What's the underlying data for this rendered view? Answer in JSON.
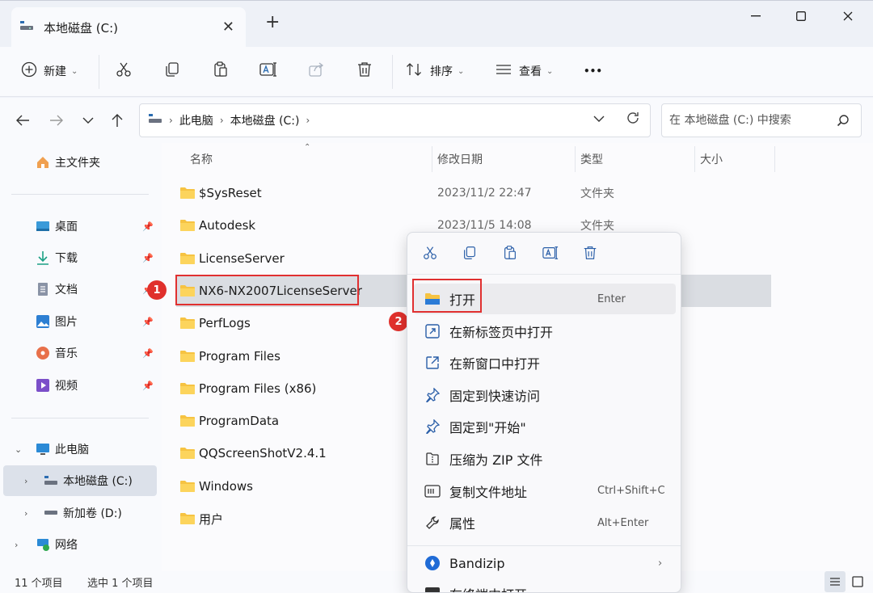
{
  "window": {
    "tab_title": "本地磁盘 (C:)",
    "minimize_glyph": "—",
    "maximize_glyph": "☐",
    "close_glyph": "✕",
    "newtab_glyph": "+"
  },
  "toolbar": {
    "new_label": "新建",
    "sort_label": "排序",
    "view_label": "查看",
    "more_label": "•••"
  },
  "nav": {
    "breadcrumb": [
      "此电脑",
      "本地磁盘 (C:)"
    ],
    "search_placeholder": "在 本地磁盘 (C:) 中搜索"
  },
  "sidebar": {
    "home": "主文件夹",
    "quick_access": [
      {
        "label": "桌面",
        "icon": "desktop-icon"
      },
      {
        "label": "下载",
        "icon": "download-icon"
      },
      {
        "label": "文档",
        "icon": "document-icon"
      },
      {
        "label": "图片",
        "icon": "picture-icon"
      },
      {
        "label": "音乐",
        "icon": "music-icon"
      },
      {
        "label": "视频",
        "icon": "video-icon"
      }
    ],
    "this_pc": "此电脑",
    "drive_c": "本地磁盘 (C:)",
    "drive_d": "新加卷 (D:)",
    "network": "网络"
  },
  "columns": {
    "name": "名称",
    "modified": "修改日期",
    "type": "类型",
    "size": "大小"
  },
  "files": [
    {
      "name": "$SysReset",
      "date": "2023/11/2 22:47",
      "type": "文件夹"
    },
    {
      "name": "Autodesk",
      "date": "2023/11/5 14:08",
      "type": "文件夹"
    },
    {
      "name": "LicenseServer",
      "date": "",
      "type": ""
    },
    {
      "name": "NX6-NX2007LicenseServer",
      "date": "",
      "type": ""
    },
    {
      "name": "PerfLogs",
      "date": "",
      "type": ""
    },
    {
      "name": "Program Files",
      "date": "",
      "type": ""
    },
    {
      "name": "Program Files (x86)",
      "date": "",
      "type": ""
    },
    {
      "name": "ProgramData",
      "date": "",
      "type": ""
    },
    {
      "name": "QQScreenShotV2.4.1",
      "date": "",
      "type": ""
    },
    {
      "name": "Windows",
      "date": "",
      "type": ""
    },
    {
      "name": "用户",
      "date": "",
      "type": ""
    }
  ],
  "context_menu": {
    "items": [
      {
        "label": "打开",
        "shortcut": "Enter",
        "icon": "folder-open-icon"
      },
      {
        "label": "在新标签页中打开",
        "shortcut": "",
        "icon": "new-tab-icon"
      },
      {
        "label": "在新窗口中打开",
        "shortcut": "",
        "icon": "new-window-icon"
      },
      {
        "label": "固定到快速访问",
        "shortcut": "",
        "icon": "pin-icon"
      },
      {
        "label": "固定到\"开始\"",
        "shortcut": "",
        "icon": "pin-start-icon"
      },
      {
        "label": "压缩为 ZIP 文件",
        "shortcut": "",
        "icon": "zip-icon"
      },
      {
        "label": "复制文件地址",
        "shortcut": "Ctrl+Shift+C",
        "icon": "copy-path-icon"
      },
      {
        "label": "属性",
        "shortcut": "Alt+Enter",
        "icon": "properties-icon"
      }
    ],
    "bandizip_label": "Bandizip",
    "terminal_label": "在终端中打开"
  },
  "annotations": {
    "badge1": "1",
    "badge2": "2"
  },
  "status": {
    "count": "11 个项目",
    "selected": "选中 1 个项目"
  },
  "colors": {
    "accent": "#0067c0",
    "folder": "#f6c342",
    "highlight_red": "#e03030"
  }
}
